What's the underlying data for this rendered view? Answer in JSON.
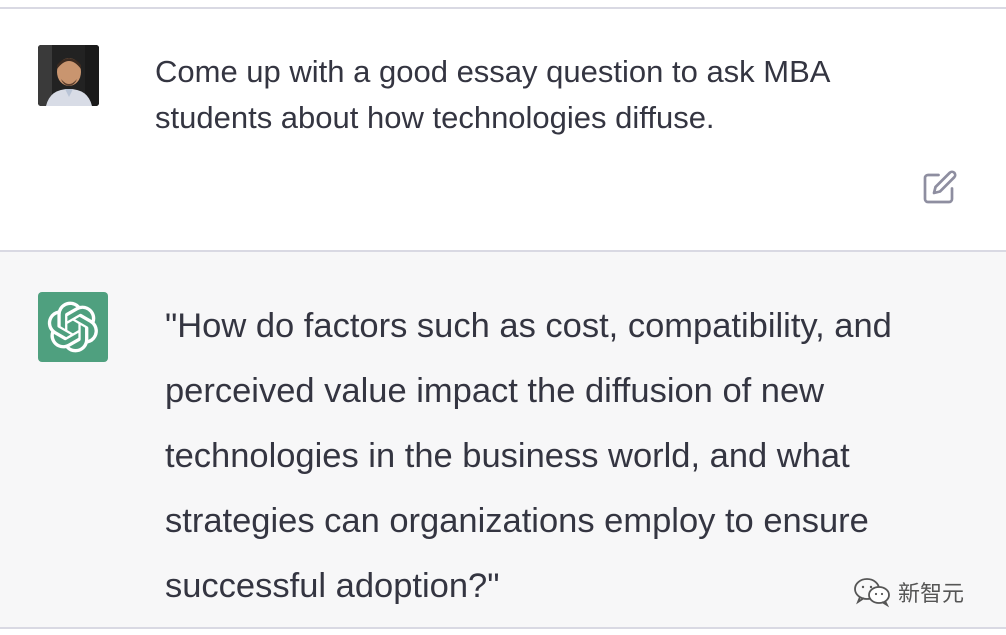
{
  "conversation": {
    "user_message": {
      "avatar_icon": "user-photo-avatar",
      "text": "Come up with a good essay question to ask MBA students about how technologies diffuse.",
      "edit_icon": "edit-icon"
    },
    "assistant_message": {
      "avatar_icon": "chatgpt-logo-icon",
      "avatar_color": "#4fa07f",
      "text": "\"How do factors such as cost, compatibility, and perceived value impact the diffusion of new technologies in the business world, and what strategies can organizations employ to ensure successful adoption?\""
    }
  },
  "watermark": {
    "icon": "wechat-icon",
    "label": "新智元"
  },
  "colors": {
    "text": "#343541",
    "assistant_bg": "#f7f7f8",
    "divider": "#d9d9e3"
  }
}
